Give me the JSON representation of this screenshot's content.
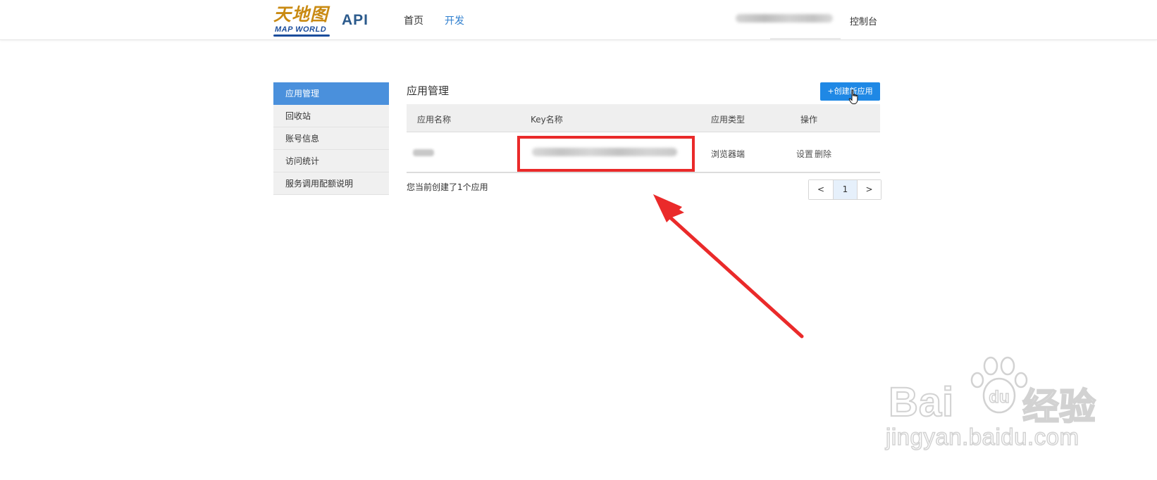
{
  "header": {
    "logo_cn": "天地图",
    "logo_en": "MAP WORLD",
    "api_label": "API",
    "nav": [
      {
        "label": "首页"
      },
      {
        "label": "开发"
      }
    ],
    "console_label": "控制台"
  },
  "sidebar": {
    "items": [
      {
        "label": "应用管理"
      },
      {
        "label": "回收站"
      },
      {
        "label": "账号信息"
      },
      {
        "label": "访问统计"
      },
      {
        "label": "服务调用配额说明"
      }
    ]
  },
  "main": {
    "title": "应用管理",
    "create_button": "+创建新应用",
    "table": {
      "headers": [
        "应用名称",
        "Key名称",
        "应用类型",
        "操作"
      ],
      "rows": [
        {
          "app_type": "浏览器端",
          "action_settings": "设置",
          "action_delete": "删除"
        }
      ]
    },
    "summary": "您当前创建了1个应用",
    "pager": {
      "prev": "<",
      "current": "1",
      "next": ">"
    }
  },
  "watermark": {
    "brand": "Bai",
    "brand_cn": "经验",
    "url": "jingyan.baidu.com"
  },
  "colors": {
    "accent": "#1f88e5",
    "sidebar_active": "#4a90dc",
    "highlight": "#ea2a2a",
    "logo_gold": "#c98a12",
    "logo_blue": "#1b4d9c"
  }
}
